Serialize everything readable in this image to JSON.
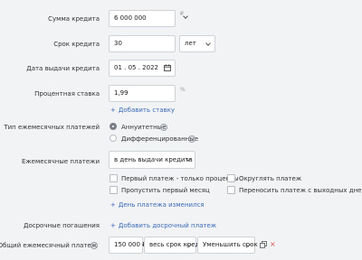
{
  "loan": {
    "amount_label": "Сумма кредита",
    "amount_value": "6 000 000",
    "amount_currency": "₽",
    "term_label": "Срок кредита",
    "term_value": "30",
    "term_unit": "лет",
    "date_label": "Дата выдачи кредита",
    "date_value": "01 . 05 . 2022",
    "rate_label": "Процентная ставка",
    "rate_value": "1,99",
    "rate_unit": "%",
    "add_rate_link": "Добавить ставку"
  },
  "payments": {
    "type_label": "Тип ежемесячных платежей",
    "type_options": [
      "Аннуитетные",
      "Дифференцированные"
    ],
    "monthly_label": "Ежемесячные платежи",
    "monthly_select": "в день выдачи кредита",
    "options": [
      "Первый платеж - только проценты",
      "Округлять платеж",
      "Пропустить первый месяц",
      "Переносить платеж с выходных дней"
    ],
    "payday_changed_link": "День платежа изменился"
  },
  "early": {
    "label": "Досрочные погашения",
    "add_link": "Добавить досрочный платеж"
  },
  "total": {
    "label": "Общий ежемесячный платеж",
    "amount": "150 000 ₽",
    "term_select": "весь срок кредита",
    "action_select": "Уменьшить срок",
    "remove_symbol": "×"
  },
  "colors": {
    "link": "#3a6bb6",
    "remove": "#d9534f"
  }
}
